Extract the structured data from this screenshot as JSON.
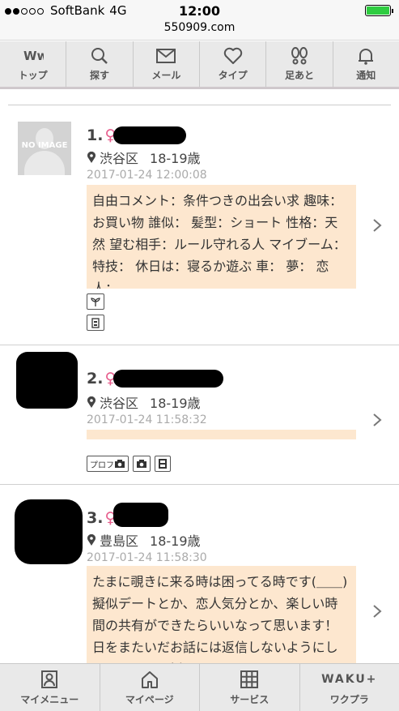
{
  "status_bar": {
    "carrier": "SoftBank",
    "network": "4G",
    "time": "12:00",
    "signal_bars": 2,
    "battery_level": 1.0
  },
  "url": "550909.com",
  "nav": [
    {
      "label": "トップ",
      "icon": "ww-logo-icon"
    },
    {
      "label": "探す",
      "icon": "search-icon"
    },
    {
      "label": "メール",
      "icon": "mail-icon"
    },
    {
      "label": "タイプ",
      "icon": "heart-icon"
    },
    {
      "label": "足あと",
      "icon": "footprint-icon"
    },
    {
      "label": "通知",
      "icon": "bell-icon"
    }
  ],
  "posts": [
    {
      "rank": "1.",
      "gender_symbol": "♀",
      "area": "渋谷区",
      "age": "18-19歳",
      "date": "2017-01-24 12:00:08",
      "avatar_text": "NO IMAGE",
      "comment": "自由コメント：条件つきの出会い求 趣味：お買い物 誰似： 髪型：ショート 性格：天然 望む相手：ルール守れる人 マイブーム： 特技： 休日は：寝るか遊ぶ 車： 夢： 恋人：",
      "tags": [
        "plant-icon",
        "building-icon"
      ]
    },
    {
      "rank": "2.",
      "gender_symbol": "♀",
      "area": "渋谷区",
      "age": "18-19歳",
      "date": "2017-01-24 11:58:32",
      "comment": "",
      "tags_label": "プロフ",
      "tags": [
        "profile-camera-icon",
        "camera-icon",
        "calculator-icon"
      ]
    },
    {
      "rank": "3.",
      "gender_symbol": "♀",
      "area": "豊島区",
      "age": "18-19歳",
      "date": "2017-01-24 11:58:30",
      "comment": "たまに覗きに来る時は困ってる時です(＿＿) 擬似デートとか、恋人気分とか、楽しい時間の共有ができたらいいなって思います！ 日をまたいだお話には返信しないようにしてるのでまた話しかけてください"
    }
  ],
  "bottom_nav": [
    {
      "label": "マイメニュー",
      "icon": "my-menu-icon"
    },
    {
      "label": "マイページ",
      "icon": "home-icon"
    },
    {
      "label": "サービス",
      "icon": "grid-icon"
    },
    {
      "label": "ワクプラ",
      "icon": "waku-plus-logo",
      "logo_text": "WAKU+"
    }
  ],
  "colors": {
    "accent_female": "#e75e8d",
    "comment_bg": "#fde7cf",
    "nav_bg": "#e9e9e9"
  }
}
